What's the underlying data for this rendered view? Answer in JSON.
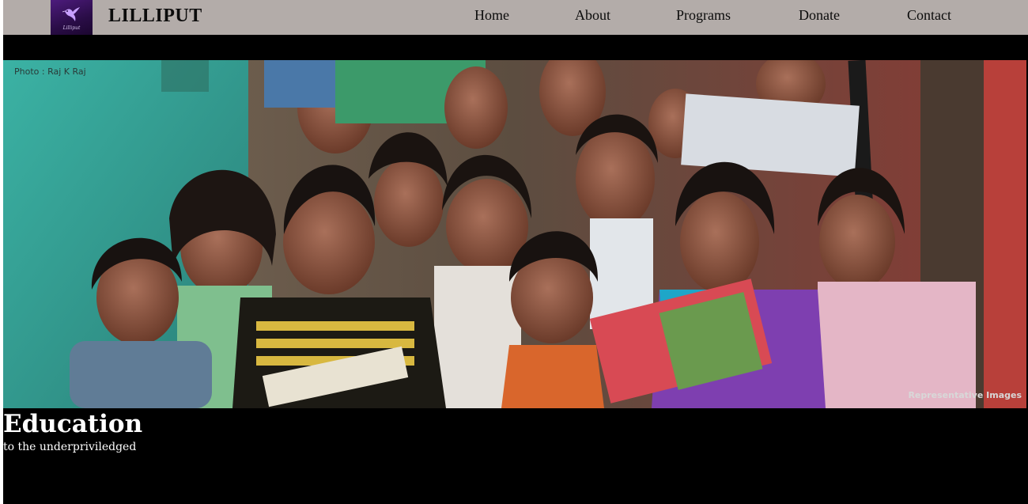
{
  "brand": {
    "name": "LILLIPUT",
    "logo_caption": "Lilliput",
    "logo_icon": "hummingbird-icon",
    "logo_color": "#4d1b7d"
  },
  "nav": {
    "items": [
      {
        "label": "Home"
      },
      {
        "label": "About"
      },
      {
        "label": "Programs"
      },
      {
        "label": "Donate"
      },
      {
        "label": "Contact"
      }
    ],
    "background": "#b3aca9"
  },
  "hero": {
    "photo_credit": "Photo : Raj K Raj",
    "watermark": "Representative Images",
    "title": "Education",
    "subtitle": "to the underpriviledged"
  }
}
